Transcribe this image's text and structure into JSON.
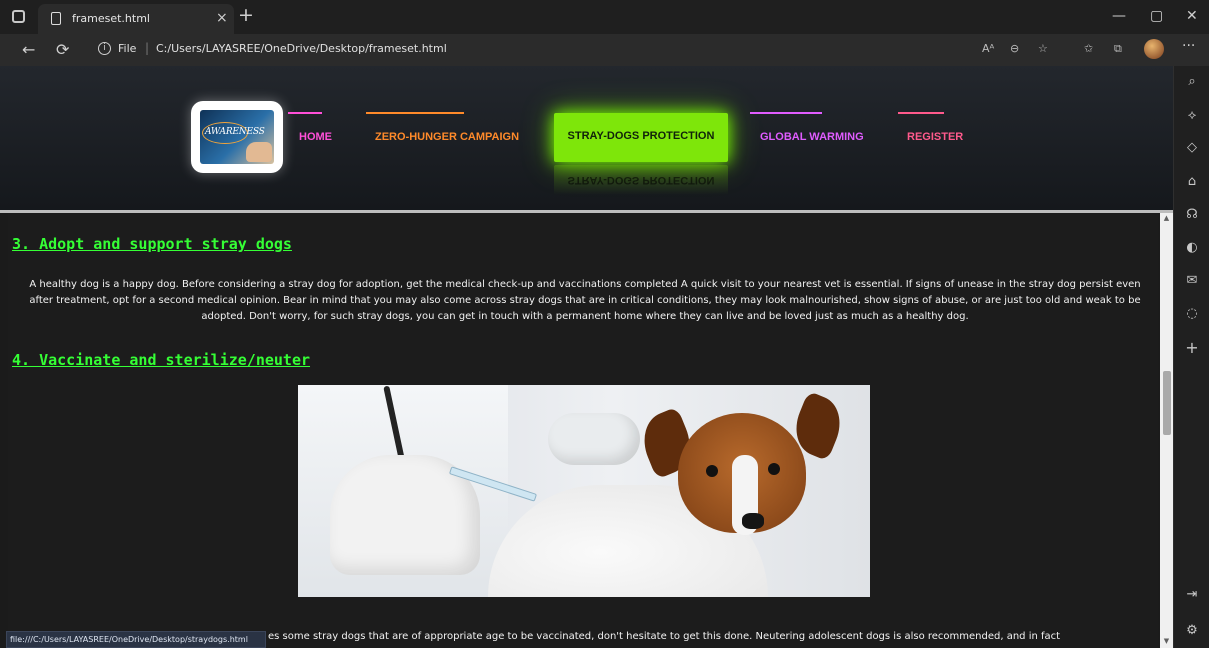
{
  "browser": {
    "tab_title": "frameset.html",
    "close_glyph": "×",
    "new_tab_glyph": "+",
    "back_glyph": "←",
    "refresh_glyph": "⟳",
    "info_glyph": "i",
    "file_label": "File",
    "url_separator": "|",
    "url": "C:/Users/LAYASREE/OneDrive/Desktop/frameset.html",
    "more_glyph": "···",
    "minimize_glyph": "—",
    "restore_glyph": "▢",
    "window_close_glyph": "✕",
    "address_icons": [
      "read-aloud-icon",
      "zoom-icon",
      "add-favorite-icon",
      "favorites-icon",
      "collections-icon",
      "profile-icon"
    ],
    "address_glyphs": [
      "Aᴬ",
      "⊖",
      "☆",
      "✩",
      "⧉"
    ],
    "sidebar_icons": [
      "search-icon",
      "copilot-icon",
      "shopping-icon",
      "tools-icon",
      "games-icon",
      "office-icon",
      "outlook-icon",
      "drop-icon",
      "add-icon",
      "sidebar-toggle-icon",
      "settings-icon"
    ],
    "sidebar_glyphs": [
      "⌕",
      "⟡",
      "◇",
      "⌂",
      "☊",
      "◐",
      "✉",
      "◌",
      "+",
      "⇥",
      "⚙"
    ]
  },
  "header": {
    "logo_text": "AWARENESS",
    "nav": [
      {
        "label": "HOME",
        "color": "#ff4fd8"
      },
      {
        "label": "ZERO-HUNGER CAMPAIGN",
        "color": "#ff8a2a"
      },
      {
        "label": "STRAY-DOGS PROTECTION",
        "color": "#7ee60a",
        "active": true
      },
      {
        "label": "GLOBAL WARMING",
        "color": "#e05cff"
      },
      {
        "label": "REGISTER",
        "color": "#ff5a8c"
      }
    ]
  },
  "content": {
    "section3_heading": "3. Adopt and support stray dogs",
    "section3_text": "A healthy dog is a happy dog. Before considering a stray dog for adoption, get the medical check-up and vaccinations completed A quick visit to your nearest vet is essential. If signs of unease in the stray dog persist even after treatment, opt for a second medical opinion. Bear in mind that you may also come across stray dogs that are in critical conditions, they may look malnourished, show signs of abuse, or are just too old and weak to be adopted. Don't worry, for such stray dogs, you can get in touch with a permanent home where they can live and be loved just as much as a healthy dog.",
    "section4_heading": "4. Vaccinate and sterilize/neuter",
    "section4_text_partial": "es some stray dogs that are of appropriate age to be vaccinated, don't hesitate to get this done. Neutering adolescent dogs is also recommended, and in fact",
    "heading_color": "#35ff35"
  },
  "statusbar": {
    "url": "file:///C:/Users/LAYASREE/OneDrive/Desktop/straydogs.html"
  },
  "scrollbar": {
    "up_glyph": "▲",
    "down_glyph": "▼",
    "position_fraction": 0.42
  }
}
